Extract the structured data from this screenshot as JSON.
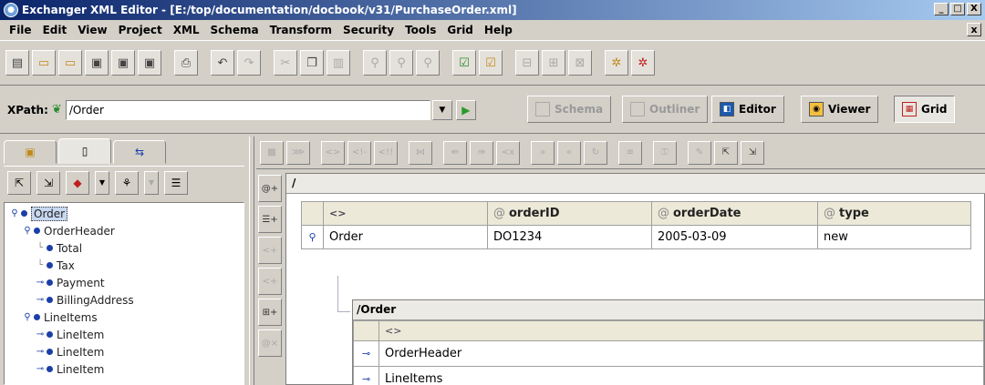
{
  "window": {
    "title": "Exchanger XML Editor - [E:/top/documentation/docbook/v31/PurchaseOrder.xml]",
    "minimize": "_",
    "maximize": "□",
    "close": "X"
  },
  "menu": {
    "items": [
      "File",
      "Edit",
      "View",
      "Project",
      "XML",
      "Schema",
      "Transform",
      "Security",
      "Tools",
      "Grid",
      "Help"
    ],
    "close": "x"
  },
  "xpath": {
    "label": "XPath:",
    "value": "/Order"
  },
  "view_buttons": {
    "schema": "Schema",
    "outliner": "Outliner",
    "editor": "Editor",
    "viewer": "Viewer",
    "grid": "Grid"
  },
  "tree": {
    "nodes": [
      {
        "label": "Order"
      },
      {
        "label": "OrderHeader"
      },
      {
        "label": "Total"
      },
      {
        "label": "Tax"
      },
      {
        "label": "Payment"
      },
      {
        "label": "BillingAddress"
      },
      {
        "label": "LineItems"
      },
      {
        "label": "LineItem"
      },
      {
        "label": "LineItem"
      },
      {
        "label": "LineItem"
      }
    ]
  },
  "grid": {
    "path": "/",
    "columns": [
      "<>",
      "orderID",
      "orderDate",
      "type"
    ],
    "row": {
      "element": "Order",
      "orderID": "DO1234",
      "orderDate": "2005-03-09",
      "type": "new"
    },
    "sub": {
      "path": "/Order",
      "column": "<>",
      "rows": [
        "OrderHeader",
        "LineItems"
      ]
    }
  },
  "colors": {
    "titlebar_start": "#0a246a",
    "titlebar_end": "#a6caf0",
    "bullet": "#1a3fa8",
    "background": "#d4d0c8"
  }
}
